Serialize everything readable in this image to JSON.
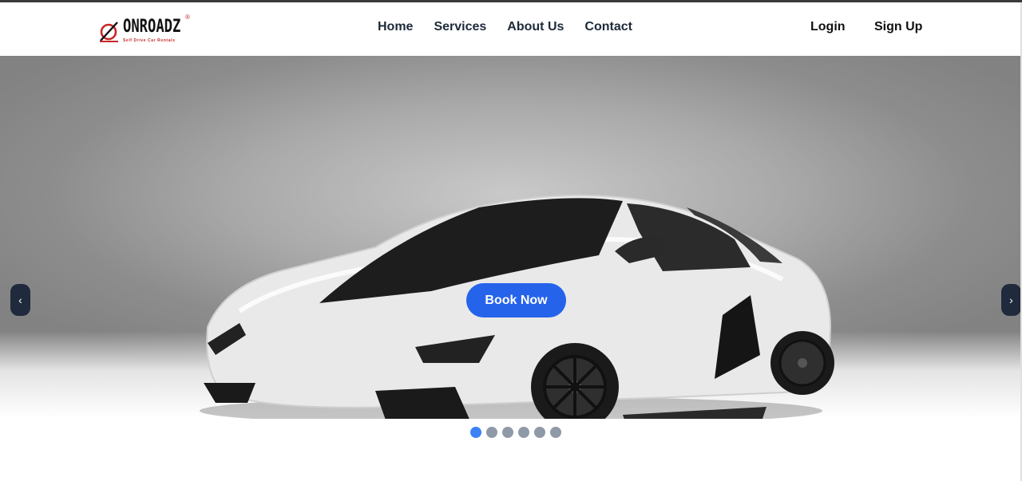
{
  "brand": {
    "name": "ONROADZ",
    "reg_mark": "®",
    "tagline": "Self Drive Car Rentals",
    "accent": "#c62828"
  },
  "nav": {
    "items": [
      {
        "label": "Home"
      },
      {
        "label": "Services"
      },
      {
        "label": "About Us"
      },
      {
        "label": "Contact"
      }
    ]
  },
  "auth": {
    "login": "Login",
    "signup": "Sign Up"
  },
  "hero": {
    "cta_label": "Book Now",
    "cta_color": "#2563eb",
    "prev_icon": "‹",
    "next_icon": "›",
    "slides": 6,
    "active_slide": 1
  }
}
